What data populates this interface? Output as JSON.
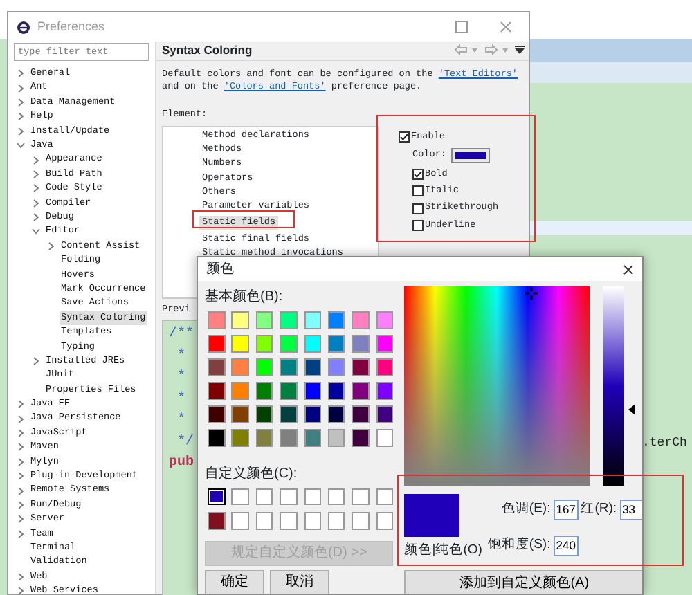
{
  "preferences": {
    "title": "Preferences",
    "filter": {
      "placeholder": "type filter text"
    },
    "tree": [
      {
        "label": "General",
        "expanded": false,
        "selected": false
      },
      {
        "label": "Ant",
        "expanded": false,
        "selected": false
      },
      {
        "label": "Data Management",
        "expanded": false,
        "selected": false
      },
      {
        "label": "Help",
        "expanded": false,
        "selected": false
      },
      {
        "label": "Install/Update",
        "expanded": false,
        "selected": false
      },
      {
        "label": "Java",
        "expanded": true,
        "selected": false,
        "children": [
          {
            "label": "Appearance",
            "expanded": false,
            "selected": false
          },
          {
            "label": "Build Path",
            "expanded": false,
            "selected": false
          },
          {
            "label": "Code Style",
            "expanded": false,
            "selected": false
          },
          {
            "label": "Compiler",
            "expanded": false,
            "selected": false
          },
          {
            "label": "Debug",
            "expanded": false,
            "selected": false
          },
          {
            "label": "Editor",
            "expanded": true,
            "selected": false,
            "children": [
              {
                "label": "Content Assist",
                "expanded": false,
                "selected": false
              },
              {
                "label": "Folding",
                "selected": false
              },
              {
                "label": "Hovers",
                "selected": false
              },
              {
                "label": "Mark Occurrence",
                "selected": false
              },
              {
                "label": "Save Actions",
                "selected": false
              },
              {
                "label": "Syntax Coloring",
                "selected": true
              },
              {
                "label": "Templates",
                "selected": false
              },
              {
                "label": "Typing",
                "selected": false
              }
            ]
          },
          {
            "label": "Installed JREs",
            "expanded": false,
            "selected": false
          },
          {
            "label": "JUnit",
            "selected": false
          },
          {
            "label": "Properties Files",
            "selected": false
          }
        ]
      },
      {
        "label": "Java EE",
        "expanded": false,
        "selected": false
      },
      {
        "label": "Java Persistence",
        "expanded": false,
        "selected": false
      },
      {
        "label": "JavaScript",
        "expanded": false,
        "selected": false
      },
      {
        "label": "Maven",
        "expanded": false,
        "selected": false
      },
      {
        "label": "Mylyn",
        "expanded": false,
        "selected": false
      },
      {
        "label": "Plug-in Development",
        "expanded": false,
        "selected": false
      },
      {
        "label": "Remote Systems",
        "expanded": false,
        "selected": false
      },
      {
        "label": "Run/Debug",
        "expanded": false,
        "selected": false
      },
      {
        "label": "Server",
        "expanded": false,
        "selected": false
      },
      {
        "label": "Team",
        "expanded": false,
        "selected": false
      },
      {
        "label": "Terminal",
        "selected": false
      },
      {
        "label": "Validation",
        "selected": false
      },
      {
        "label": "Web",
        "expanded": false,
        "selected": false
      },
      {
        "label": "Web Services",
        "expanded": false,
        "selected": false
      }
    ],
    "page": {
      "title": "Syntax Coloring",
      "description": [
        {
          "text": "Default colors and font can be configured on the ",
          "link": "'Text Editors'"
        },
        {
          "text": "and on the ",
          "link": "'Colors and Fonts'",
          "after": " preference page."
        }
      ],
      "element_label": "Element:",
      "elements": [
        {
          "label": "Method declarations",
          "selected": false
        },
        {
          "label": "Methods",
          "selected": false
        },
        {
          "label": "Numbers",
          "selected": false
        },
        {
          "label": "Operators",
          "selected": false
        },
        {
          "label": "Others",
          "selected": false
        },
        {
          "label": "Parameter variables",
          "selected": false
        },
        {
          "label": "Static fields",
          "selected": true
        },
        {
          "label": "Static final fields",
          "selected": false
        },
        {
          "label": "Static method invocations",
          "selected": false
        }
      ],
      "enable": {
        "label": "Enable",
        "checked": true
      },
      "color": {
        "label": "Color:",
        "color": "#1c00a8"
      },
      "styles": [
        {
          "label": "Bold",
          "checked": true
        },
        {
          "label": "Italic",
          "checked": false
        },
        {
          "label": "Strikethrough",
          "checked": false
        },
        {
          "label": "Underline",
          "checked": false
        }
      ],
      "preview_label": "Previ",
      "preview_lines": [
        "/**",
        " *",
        " *",
        " *",
        " *",
        " */",
        "pub"
      ]
    }
  },
  "editor_background": {
    "visible_text": ".terCh"
  },
  "color_dialog": {
    "title": "颜色",
    "basic_label": "基本颜色(B):",
    "basic_colors": [
      {
        "color": "#ff8080"
      },
      {
        "color": "#ffff80"
      },
      {
        "color": "#80ff80"
      },
      {
        "color": "#00ff80"
      },
      {
        "color": "#80ffff"
      },
      {
        "color": "#0080ff"
      },
      {
        "color": "#ff80c0"
      },
      {
        "color": "#ff80ff"
      },
      {
        "color": "#ff0000"
      },
      {
        "color": "#ffff00"
      },
      {
        "color": "#80ff00"
      },
      {
        "color": "#00ff40"
      },
      {
        "color": "#00ffff"
      },
      {
        "color": "#0080c0"
      },
      {
        "color": "#8080c0"
      },
      {
        "color": "#ff00ff"
      },
      {
        "color": "#804040"
      },
      {
        "color": "#ff8040"
      },
      {
        "color": "#00ff00"
      },
      {
        "color": "#008080"
      },
      {
        "color": "#004080"
      },
      {
        "color": "#8080ff"
      },
      {
        "color": "#800040"
      },
      {
        "color": "#ff0080"
      },
      {
        "color": "#800000"
      },
      {
        "color": "#ff8000"
      },
      {
        "color": "#008000"
      },
      {
        "color": "#008040"
      },
      {
        "color": "#0000ff"
      },
      {
        "color": "#0000a0"
      },
      {
        "color": "#800080"
      },
      {
        "color": "#8000ff"
      },
      {
        "color": "#400000"
      },
      {
        "color": "#804000"
      },
      {
        "color": "#004000"
      },
      {
        "color": "#004040"
      },
      {
        "color": "#000080"
      },
      {
        "color": "#000040"
      },
      {
        "color": "#400040"
      },
      {
        "color": "#400080"
      },
      {
        "color": "#000000"
      },
      {
        "color": "#808000"
      },
      {
        "color": "#808040"
      },
      {
        "color": "#808080"
      },
      {
        "color": "#408080"
      },
      {
        "color": "#c0c0c0"
      },
      {
        "color": "#400040"
      },
      {
        "color": "#ffffff"
      }
    ],
    "custom_label": "自定义颜色(C):",
    "custom_colors": [
      {
        "color": "#2000b0",
        "selected": true
      },
      {
        "color": "#ffffff",
        "selected": false
      },
      {
        "color": "#ffffff",
        "selected": false
      },
      {
        "color": "#ffffff",
        "selected": false
      },
      {
        "color": "#ffffff",
        "selected": false
      },
      {
        "color": "#ffffff",
        "selected": false
      },
      {
        "color": "#ffffff",
        "selected": false
      },
      {
        "color": "#ffffff",
        "selected": false
      },
      {
        "color": "#801020",
        "selected": false
      },
      {
        "color": "#ffffff",
        "selected": false
      },
      {
        "color": "#ffffff",
        "selected": false
      },
      {
        "color": "#ffffff",
        "selected": false
      },
      {
        "color": "#ffffff",
        "selected": false
      },
      {
        "color": "#ffffff",
        "selected": false
      },
      {
        "color": "#ffffff",
        "selected": false
      },
      {
        "color": "#ffffff",
        "selected": false
      }
    ],
    "define_button": {
      "label": "规定自定义颜色(D) >>",
      "disabled": true
    },
    "ok": "确定",
    "cancel": "取消",
    "luminance": {
      "level": 0.38
    },
    "current": {
      "color": "#2000b8",
      "label": "颜色|纯色(O)"
    },
    "fields": [
      {
        "label": "色调(E):",
        "value": "167"
      },
      {
        "label": "红(R):",
        "value": "33"
      },
      {
        "label": "饱和度(S):",
        "value": "240"
      }
    ],
    "add_button": "添加到自定义颜色(A)"
  }
}
